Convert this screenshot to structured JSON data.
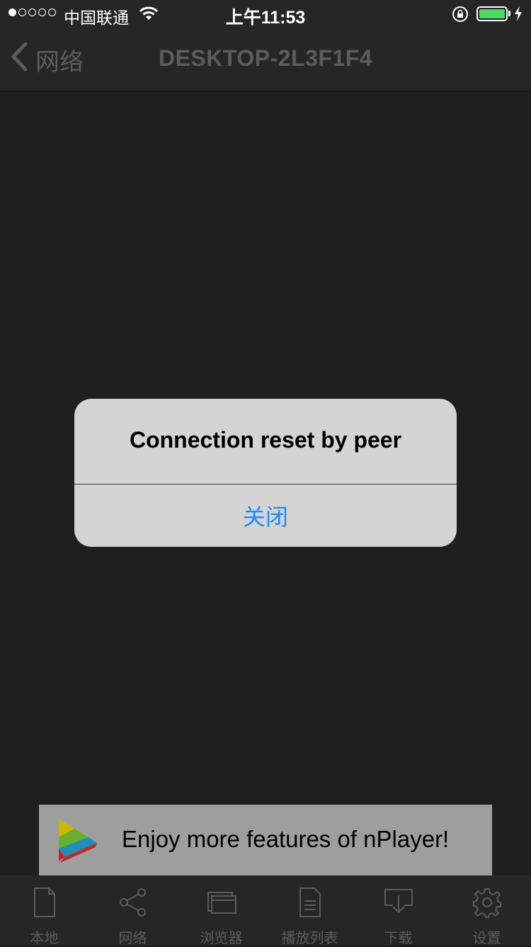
{
  "status_bar": {
    "carrier": "中国联通",
    "time": "上午11:53"
  },
  "nav": {
    "back_label": "网络",
    "title": "DESKTOP-2L3F1F4"
  },
  "alert": {
    "message": "Connection reset by peer",
    "button_label": "关闭"
  },
  "ad": {
    "text": "Enjoy more features of nPlayer!"
  },
  "tabs": [
    {
      "label": "本地",
      "icon": "file-icon"
    },
    {
      "label": "网络",
      "icon": "share-icon"
    },
    {
      "label": "浏览器",
      "icon": "browser-icon"
    },
    {
      "label": "播放列表",
      "icon": "playlist-icon"
    },
    {
      "label": "下载",
      "icon": "download-icon"
    },
    {
      "label": "设置",
      "icon": "gear-icon"
    }
  ],
  "colors": {
    "background": "#1f1f1f",
    "bar": "#262626",
    "muted_text": "#5c5c5c",
    "alert_bg": "#d4d4d4",
    "alert_button": "#1a8cff",
    "battery": "#4cd964"
  }
}
